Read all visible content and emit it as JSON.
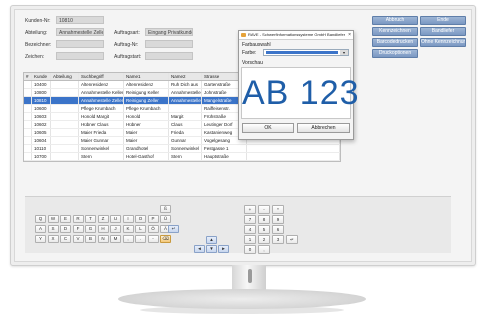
{
  "form": {
    "kunden_nr_label": "Kunden-Nr:",
    "kunden_nr_value": "10810",
    "abteilung_label": "Abteilung:",
    "abteilung_value": "Annahmestelle Zeller",
    "auftragsart_label": "Auftragsart:",
    "auftragsart_value": "Eingang Privatkunde",
    "bezeichner_label": "Bezeichner:",
    "auftrag_nr_label": "Auftrag-Nr:",
    "zeichen_label": "Zeichen:",
    "auftragstart_label": "Auftragstart:"
  },
  "right_buttons": {
    "abbruch": "Abbruch",
    "ende": "Ende",
    "kennzeichnen": "Kennzeichnen",
    "bandliefer": "Bandliefer",
    "barcodedrucken": "Barcodedrucken",
    "ohne_kennzeichnung": "Ohne Kennzeichnung",
    "druckoptionen": "Druckoptionen"
  },
  "table": {
    "columns": [
      "#",
      "Kunde",
      "Abteilung",
      "Suchbegriff",
      "Name1",
      "Name2",
      "Strasse"
    ],
    "rows": [
      [
        "",
        "10400",
        "",
        "Altenresidenz",
        "Altenresidenz",
        "Ruh Dich aus",
        "Gartenstraße"
      ],
      [
        "",
        "10800",
        "",
        "Annahmestelle Keller",
        "Reinigung Keller",
        "Annahmestelle",
        "Johnstraße"
      ],
      [
        "",
        "10810",
        "",
        "Annahmestelle Zeller",
        "Reinigung Zeller",
        "Annahmestelle",
        "Mangelstraße"
      ],
      [
        "",
        "10600",
        "",
        "Pflege Krumbach",
        "Pflege Krumbach",
        "",
        "Raiffeisenstr."
      ],
      [
        "",
        "10603",
        "",
        "Honold Margit",
        "Honold",
        "Margit",
        "Frühstraße"
      ],
      [
        "",
        "10602",
        "",
        "Hübner Claus",
        "Hübner",
        "Claus",
        "Leutinger Dorf"
      ],
      [
        "",
        "10605",
        "",
        "Maier Frieda",
        "Maier",
        "Frieda",
        "Kastanienweg"
      ],
      [
        "",
        "10604",
        "",
        "Maier Gunnar",
        "Maier",
        "Gunnar",
        "Vogelgesang"
      ],
      [
        "",
        "10110",
        "",
        "Sonnenwinkel",
        "Grandhotel",
        "Sonnenwinkel",
        "Festgasse 1"
      ],
      [
        "",
        "10700",
        "",
        "Stern",
        "Hotel-Gasthof",
        "Stern",
        "Hauptstraße"
      ]
    ],
    "selected_row": 2
  },
  "dialog": {
    "title": "RAVE - Schwerfinformationssysteme GmbH Bandliefer",
    "close_glyph": "×",
    "farbauswahl_label": "Farbauswahl",
    "farbe_label": "Farbe:",
    "combo_arrow": "▾",
    "vorschau_label": "Vorschau",
    "preview_text": "AB 123",
    "ok_label": "OK",
    "abbrechen_label": "Abbrechen",
    "accent_color": "#3b74c9"
  },
  "keyboard": {
    "row1": [
      "Q",
      "W",
      "E",
      "R",
      "T",
      "Z",
      "U",
      "I",
      "O",
      "P",
      "Ü"
    ],
    "row2": [
      "A",
      "S",
      "D",
      "F",
      "G",
      "H",
      "J",
      "K",
      "L",
      "Ö",
      "Ä"
    ],
    "row3": [
      "Y",
      "X",
      "C",
      "V",
      "B",
      "N",
      "M",
      ",",
      ".",
      "-"
    ],
    "extra_top": "ß",
    "backspace_glyph": "⌫",
    "enter_glyph": "↵",
    "arrow_glyphs": [
      "▲",
      "◄",
      "▼",
      "►"
    ],
    "numpad_top": [
      "+",
      "-",
      "*"
    ],
    "numpad": [
      [
        "7",
        "8",
        "9"
      ],
      [
        "4",
        "5",
        "6"
      ],
      [
        "1",
        "2",
        "3"
      ],
      [
        "0",
        ","
      ]
    ],
    "numpad_enter": "↵"
  }
}
